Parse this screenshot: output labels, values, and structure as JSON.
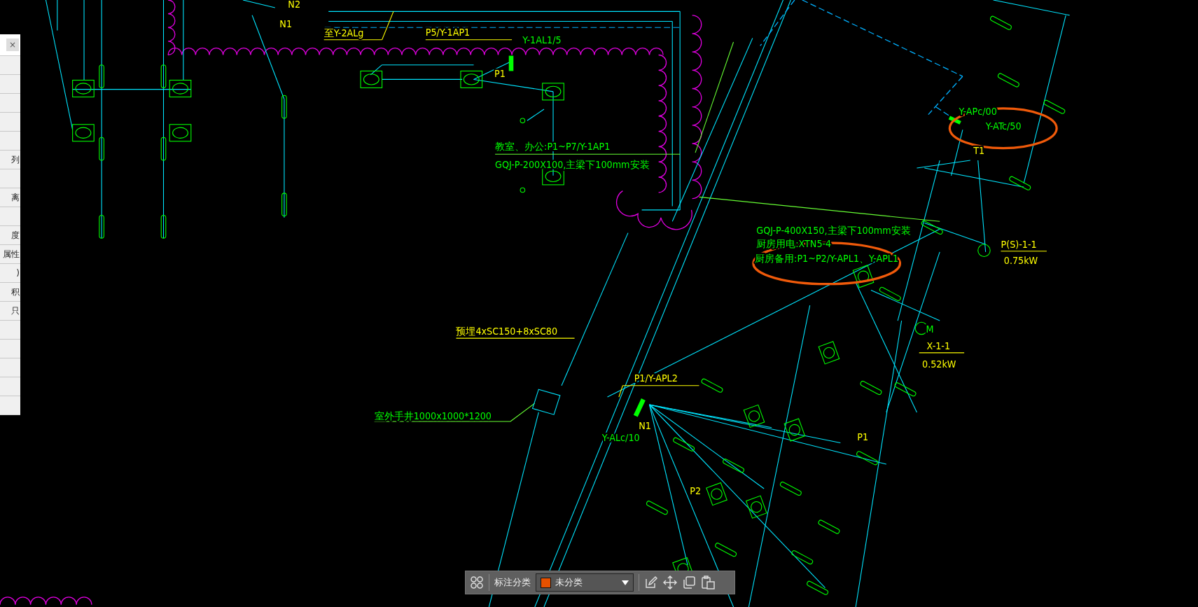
{
  "side_panel": {
    "close": "×",
    "rows": [
      {
        "label": "列"
      },
      {
        "label": "离"
      },
      {
        "label": "度"
      },
      {
        "label": "属性"
      },
      {
        "label": ")"
      },
      {
        "label": "积"
      },
      {
        "label": "只"
      }
    ]
  },
  "drawing": {
    "labels": [
      {
        "text": "N2",
        "kind": "yellow"
      },
      {
        "text": "N1",
        "kind": "yellow"
      },
      {
        "text": "至Y-2ALg",
        "kind": "yellow"
      },
      {
        "text": "P5/Y-1AP1",
        "kind": "yellow"
      },
      {
        "text": "Y-1AL1/5",
        "kind": "green"
      },
      {
        "text": "P1",
        "kind": "yellow"
      },
      {
        "text": "教室、办公:P1~P7/Y-1AP1",
        "kind": "green"
      },
      {
        "text": "GQJ-P-200X100,主梁下100mm安装",
        "kind": "green"
      },
      {
        "text": "Y-APc/00",
        "kind": "green"
      },
      {
        "text": "Y-ATc/50",
        "kind": "green"
      },
      {
        "text": "T1",
        "kind": "yellow"
      },
      {
        "text": "GQJ-P-400X150,主梁下100mm安装",
        "kind": "green"
      },
      {
        "text": "厨房用电:XTN5-4",
        "kind": "green"
      },
      {
        "text": "厨房备用:P1~P2/Y-APL1、Y-APL1",
        "kind": "green"
      },
      {
        "text": "P(S)-1-1",
        "kind": "yellow"
      },
      {
        "text": "0.75kW",
        "kind": "yellow"
      },
      {
        "text": "M",
        "kind": "green"
      },
      {
        "text": "X-1-1",
        "kind": "yellow"
      },
      {
        "text": "0.52kW",
        "kind": "yellow"
      },
      {
        "text": "预埋4xSC150+8xSC80",
        "kind": "yellow"
      },
      {
        "text": "室外手井1000x1000*1200",
        "kind": "green"
      },
      {
        "text": "P1/Y-APL2",
        "kind": "yellow"
      },
      {
        "text": "N1",
        "kind": "yellow"
      },
      {
        "text": "Y-ALc/10",
        "kind": "green"
      },
      {
        "text": "P1",
        "kind": "yellow"
      },
      {
        "text": "P2",
        "kind": "yellow"
      }
    ]
  },
  "toolbar": {
    "label": "标注分类",
    "category": {
      "value": "未分类",
      "color": "#e65100"
    }
  }
}
